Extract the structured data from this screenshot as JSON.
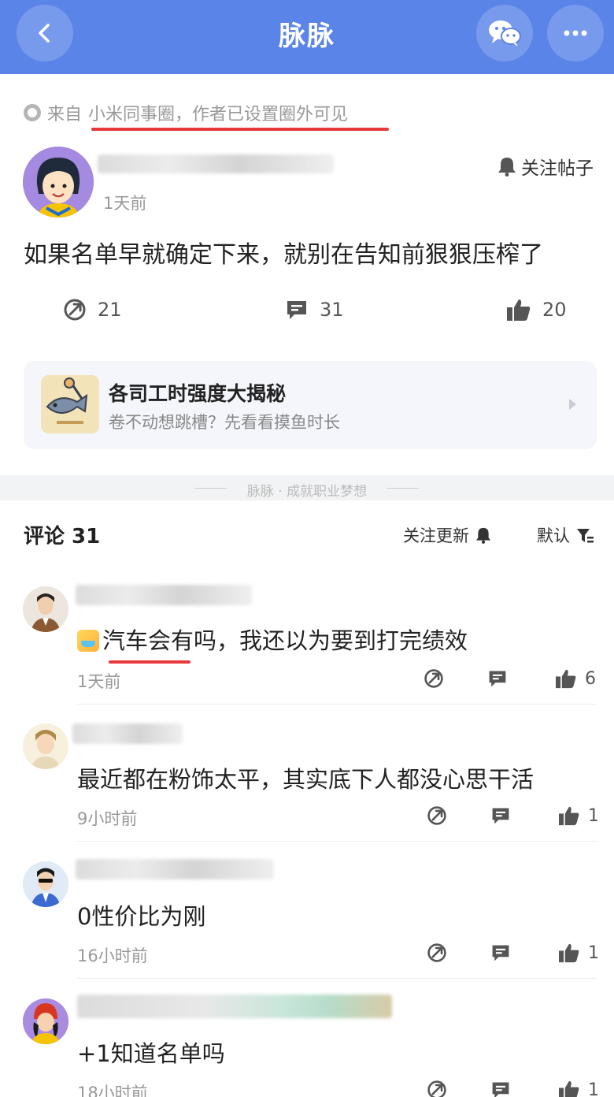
{
  "header": {
    "title": "脉脉",
    "back_icon": "chevron-left-icon",
    "wechat_icon": "wechat-icon",
    "more_icon": "more-dots-icon",
    "bg_color": "#5b84e8"
  },
  "post": {
    "source_prefix": "来自",
    "source_text": "小米同事圈，作者已设置圈外可见",
    "time": "1天前",
    "follow_label": "关注帖子",
    "text": "如果名单早就确定下来，就别在告知前狠狠压榨了",
    "stats": {
      "shares": "21",
      "comments": "31",
      "likes": "20"
    }
  },
  "promo": {
    "title": "各司工时强度大揭秘",
    "subtitle": "卷不动想跳槽？先看看摸鱼时长"
  },
  "band_text": "脉脉 · 成就职业梦想",
  "comments_section": {
    "title": "评论 31",
    "follow_label": "关注更新",
    "sort_label": "默认"
  },
  "comments": [
    {
      "text": "汽车会有吗，我还以为要到打完绩效",
      "time": "1天前",
      "likes": "6"
    },
    {
      "text": "最近都在粉饰太平，其实底下人都没心思干活",
      "time": "9小时前",
      "likes": "1"
    },
    {
      "text": "0性价比为刚",
      "time": "16小时前",
      "likes": "1"
    },
    {
      "text": "+1知道名单吗",
      "time": "18小时前",
      "likes": "1"
    }
  ],
  "accent_color": "#e8383d"
}
